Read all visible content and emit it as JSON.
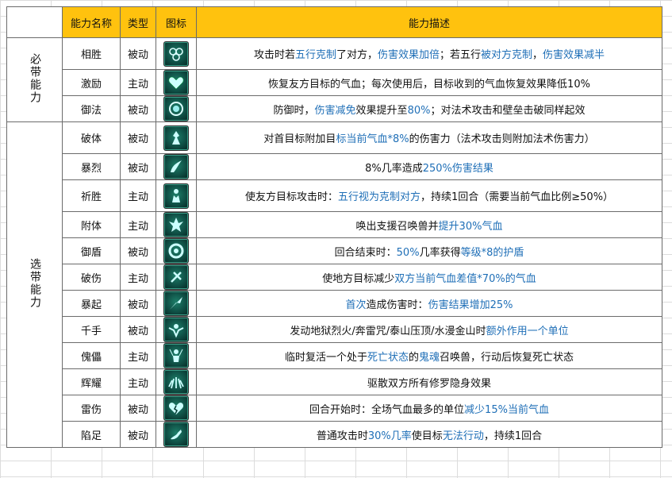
{
  "header": {
    "col_group": "",
    "col_name": "能力名称",
    "col_type": "类型",
    "col_icon": "图标",
    "col_desc": "能力描述"
  },
  "groups": {
    "required": "必带能力",
    "optional": "选带能力"
  },
  "rows": [
    {
      "name": "相胜",
      "type": "被动",
      "icon": "five-rings-icon",
      "desc": [
        {
          "t": "攻击时若"
        },
        {
          "t": "五行克制",
          "hl": true
        },
        {
          "t": "了对方，"
        },
        {
          "t": "伤害效果加倍",
          "hl": true
        },
        {
          "t": "；若五行"
        },
        {
          "t": "被对方克制",
          "hl": true
        },
        {
          "t": "，"
        },
        {
          "t": "伤害效果减半",
          "hl": true
        }
      ]
    },
    {
      "name": "激励",
      "type": "主动",
      "icon": "heart-icon",
      "desc": [
        {
          "t": "恢复友方目标的气血；每次使用后，目标收到的气血恢复效果降低10%"
        }
      ]
    },
    {
      "name": "御法",
      "type": "被动",
      "icon": "shield-orb-icon",
      "desc": [
        {
          "t": "防御时，"
        },
        {
          "t": "伤害减免",
          "hl": true
        },
        {
          "t": "效果提升至"
        },
        {
          "t": "80%",
          "hl": true
        },
        {
          "t": "；对法术攻击和壁垒击破同样起效"
        }
      ]
    },
    {
      "name": "破体",
      "type": "被动",
      "icon": "broken-body-icon",
      "desc": [
        {
          "t": "对首目标附加目"
        },
        {
          "t": "标当前气血*8%",
          "hl": true
        },
        {
          "t": "的伤害力（法术攻击则附加法术伤害力）"
        }
      ]
    },
    {
      "name": "暴烈",
      "type": "被动",
      "icon": "flame-slash-icon",
      "desc": [
        {
          "t": "8%几率造成"
        },
        {
          "t": "250%伤害结果",
          "hl": true
        }
      ]
    },
    {
      "name": "祈胜",
      "type": "主动",
      "icon": "praying-figure-icon",
      "desc": [
        {
          "t": "使友方目标攻击时："
        },
        {
          "t": "五行视为克制对方",
          "hl": true
        },
        {
          "t": "，持续1回合（需要当前气血比例≥50%）"
        }
      ]
    },
    {
      "name": "附体",
      "type": "主动",
      "icon": "spirit-figure-icon",
      "desc": [
        {
          "t": "唤出支援召唤兽并"
        },
        {
          "t": "提升30%气血",
          "hl": true
        }
      ]
    },
    {
      "name": "御盾",
      "type": "被动",
      "icon": "round-shield-icon",
      "desc": [
        {
          "t": "回合结束时："
        },
        {
          "t": "50%",
          "hl": true
        },
        {
          "t": "几率获得"
        },
        {
          "t": "等级*8的护盾",
          "hl": true
        }
      ]
    },
    {
      "name": "破伤",
      "type": "主动",
      "icon": "wound-icon",
      "desc": [
        {
          "t": "使地方目标减少"
        },
        {
          "t": "双方当前气血差值*70%的气血",
          "hl": true
        }
      ]
    },
    {
      "name": "暴起",
      "type": "被动",
      "icon": "rising-blade-icon",
      "desc": [
        {
          "t": "首次",
          "hl": true
        },
        {
          "t": "造成伤害时："
        },
        {
          "t": "伤害结果增加25%",
          "hl": true
        }
      ]
    },
    {
      "name": "千手",
      "type": "被动",
      "icon": "many-hands-icon",
      "desc": [
        {
          "t": "发动地狱烈火/奔雷咒/泰山压顶/水漫金山时"
        },
        {
          "t": "额外作用一个单位",
          "hl": true
        }
      ]
    },
    {
      "name": "傀儡",
      "type": "主动",
      "icon": "puppet-icon",
      "desc": [
        {
          "t": "临时复活一个处于"
        },
        {
          "t": "死亡状态",
          "hl": true
        },
        {
          "t": "的"
        },
        {
          "t": "鬼魂",
          "hl": true
        },
        {
          "t": "召唤兽，行动后恢复死亡状态"
        }
      ]
    },
    {
      "name": "辉耀",
      "type": "主动",
      "icon": "radiance-icon",
      "desc": [
        {
          "t": "驱散双方所有修罗隐身效果"
        }
      ]
    },
    {
      "name": "雷伤",
      "type": "被动",
      "icon": "broken-heart-icon",
      "desc": [
        {
          "t": "回合开始时：全场气血最多的单位"
        },
        {
          "t": "减少15%当前气血",
          "hl": true
        }
      ]
    },
    {
      "name": "陷足",
      "type": "被动",
      "icon": "trapped-foot-icon",
      "desc": [
        {
          "t": "普通攻击时"
        },
        {
          "t": "30%几率",
          "hl": true
        },
        {
          "t": "使目标"
        },
        {
          "t": "无法行动",
          "hl": true
        },
        {
          "t": "，持续1回合"
        }
      ]
    }
  ]
}
